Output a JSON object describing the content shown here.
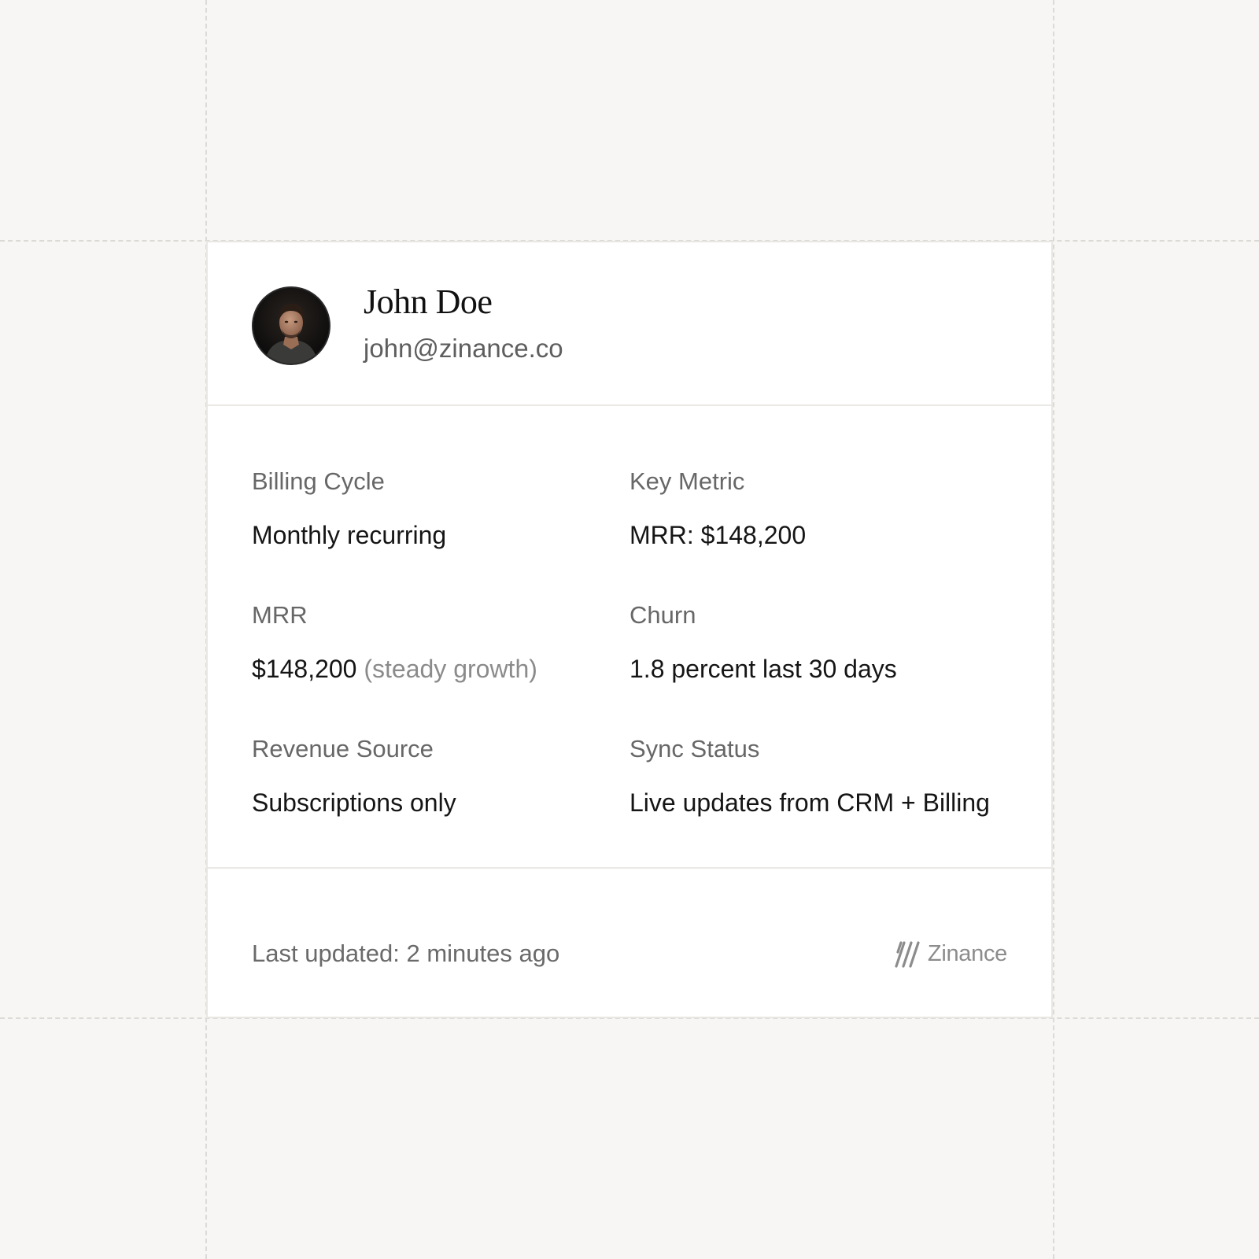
{
  "profile": {
    "name": "John Doe",
    "email": "john@zinance.co",
    "avatar_icon": "person-avatar"
  },
  "fields": {
    "billing_cycle": {
      "label": "Billing Cycle",
      "value": "Monthly recurring"
    },
    "key_metric": {
      "label": "Key Metric",
      "value": "MRR: $148,200"
    },
    "mrr": {
      "label": "MRR",
      "value": "$148,200",
      "note": "(steady growth)"
    },
    "churn": {
      "label": "Churn",
      "value": "1.8 percent last 30 days"
    },
    "revenue_source": {
      "label": "Revenue Source",
      "value": "Subscriptions only"
    },
    "sync_status": {
      "label": "Sync Status",
      "value": "Live updates from CRM + Billing"
    }
  },
  "footer": {
    "updated_text": "Last updated: 2 minutes ago",
    "brand_name": "Zinance",
    "brand_icon": "zinance-logo-icon"
  },
  "colors": {
    "background": "#f7f6f4",
    "card": "#ffffff",
    "text_primary": "#151515",
    "text_secondary": "#676767",
    "text_muted": "#8b8b8b"
  }
}
